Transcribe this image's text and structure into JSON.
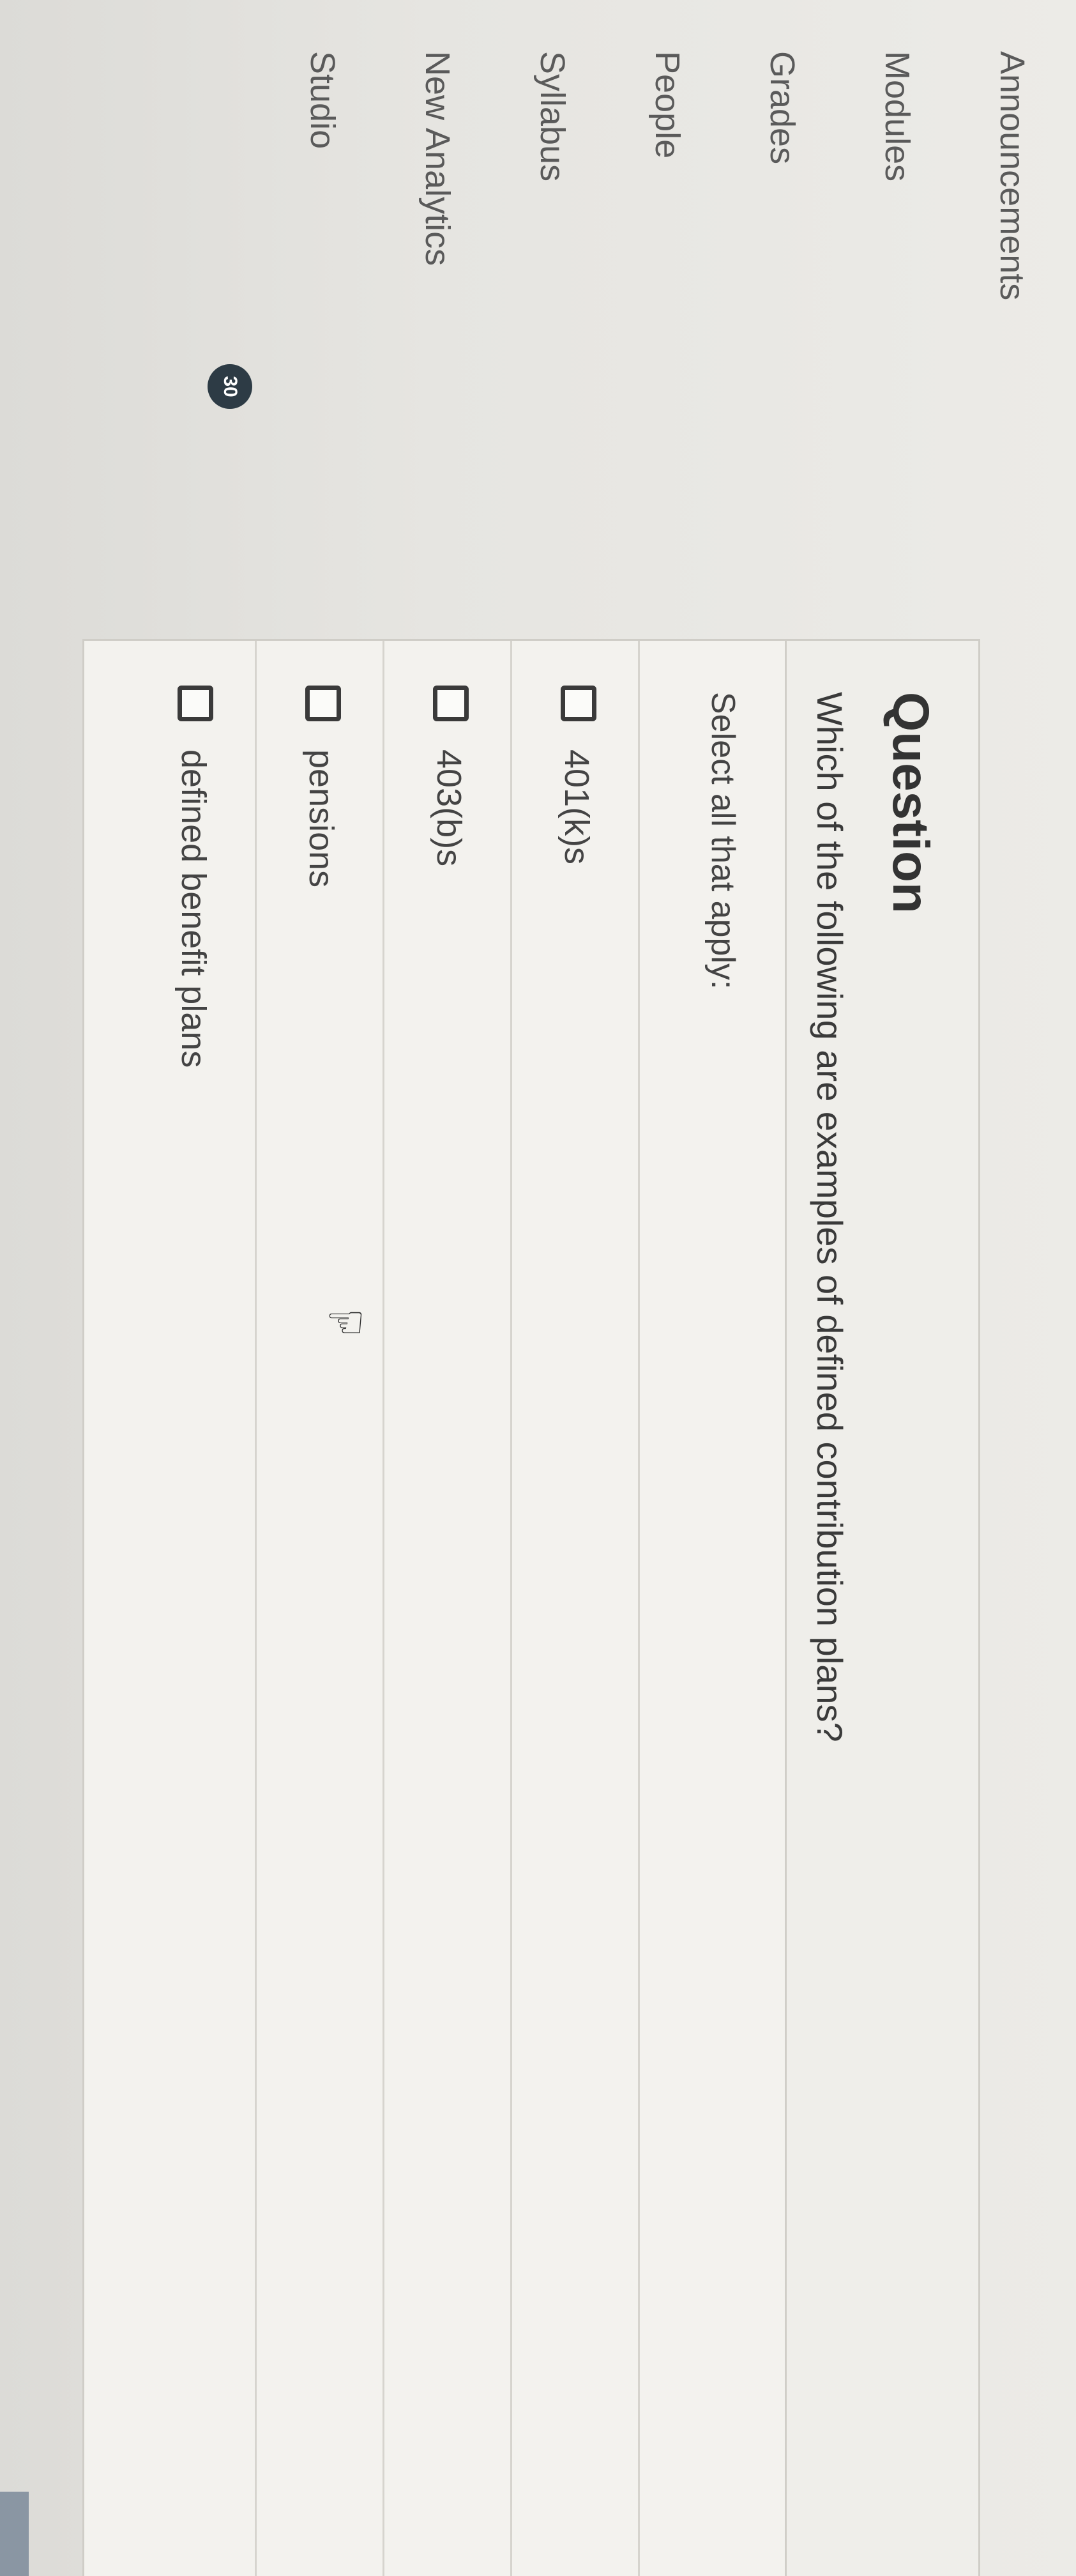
{
  "course_nav": {
    "items": [
      {
        "label": "Announcements"
      },
      {
        "label": "Modules"
      },
      {
        "label": "Grades"
      },
      {
        "label": "People"
      },
      {
        "label": "Syllabus"
      },
      {
        "label": "New Analytics"
      },
      {
        "label": "Studio"
      }
    ],
    "grades_badge": "30"
  },
  "question": {
    "title": "Question",
    "text": "Which of the following are examples of defined contribution plans?",
    "instruction": "Select all that apply:",
    "answers": [
      {
        "label": "401(k)s",
        "checked": false
      },
      {
        "label": "403(b)s",
        "checked": false
      },
      {
        "label": "pensions",
        "checked": false
      },
      {
        "label": "defined benefit plans",
        "checked": false
      }
    ]
  },
  "icons": {
    "cursor": "hand-pointer-icon"
  }
}
